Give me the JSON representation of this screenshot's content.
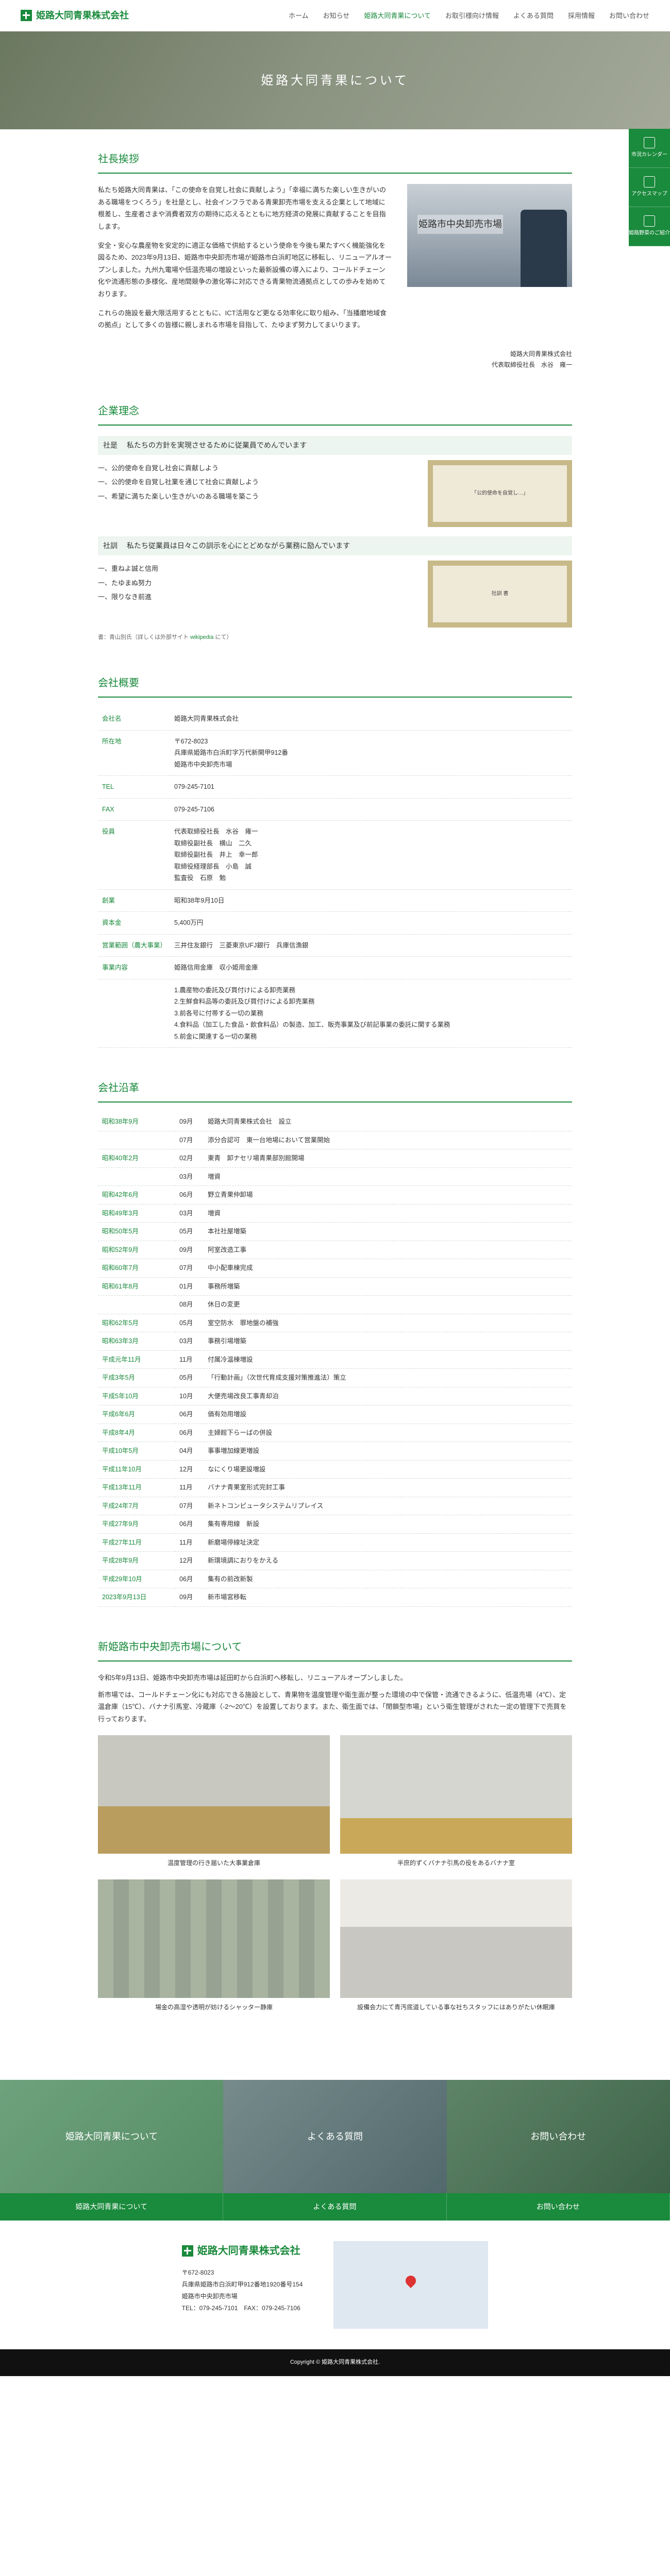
{
  "site": {
    "name": "姫路大同青果株式会社"
  },
  "nav": {
    "items": [
      "ホーム",
      "お知らせ",
      "姫路大同青果について",
      "お取引様向け情報",
      "よくある質問",
      "採用情報",
      "お問い合わせ"
    ],
    "activeIndex": 2
  },
  "hero": {
    "title": "姫路大同青果について"
  },
  "sidetabs": [
    {
      "label": "市況カレンダー"
    },
    {
      "label": "アクセスマップ"
    },
    {
      "label": "姫路野菜のご紹介"
    }
  ],
  "sections": {
    "president": {
      "heading": "社長挨拶",
      "paragraphs": [
        "私たち姫路大同青果は、「この使命を自覚し社会に貢献しよう」「幸福に満ちた楽しい生きがいのある職場をつくろう」を社是とし、社会インフラである青果卸売市場を支える企業として地域に根差し、生産者さまや消費者双方の期待に応えるとともに地方経済の発展に貢献することを目指します。",
        "安全・安心な農産物を安定的に適正な価格で供給するという使命を今後も果たすべく機能強化を図るため、2023年9月13日、姫路市中央卸売市場が姫路市白浜町地区に移転し、リニューアルオープンしました。九州九電場や低温売場の増設といった最新設備の導入により、コールドチェーン化や流通形態の多様化、産地間競争の激化等に対応できる青果物流通拠点としての歩みを始めております。",
        "これらの施設を最大限活用するとともに、ICT活用など更なる効率化に取り組み、「当播磨地域食の拠点」として多くの皆様に親しまれる市場を目指して、たゆまず努力してまいります。"
      ],
      "sig_company": "姫路大同青果株式会社",
      "sig_title": "代表取締役社長",
      "sig_name": "水谷　雍一"
    },
    "philosophy": {
      "heading": "企業理念",
      "shazeLabel": "社是",
      "shazeLead": "私たちの方針を実現させるために従業員でめんでいます",
      "shaze": [
        "公的使命を自覚し社会に貢献しよう",
        "公的使命を自覚し社業を通じて社会に貢献しよう",
        "希望に満ちた楽しい生きがいのある職場を築こう"
      ],
      "shakunLabel": "社訓",
      "shakunLead": "私たち従業員は日々この訓示を心にとどめながら業務に励んでいます",
      "shakun": [
        "重ねよ誠と信用",
        "たゆまぬ努力",
        "限りなき前進"
      ],
      "note_pre": "書：青山別氏（詳しくは外部サイト ",
      "note_link": "wikipedia",
      "note_post": " にて）"
    },
    "overview": {
      "heading": "会社概要",
      "rows": [
        {
          "k": "会社名",
          "v": "姫路大同青果株式会社"
        },
        {
          "k": "所在地",
          "v": "〒672-8023\n兵庫県姫路市白浜町字万代新開甲912番\n姫路市中央卸売市場"
        },
        {
          "k": "TEL",
          "v": "079-245-7101"
        },
        {
          "k": "FAX",
          "v": "079-245-7106"
        },
        {
          "k": "役員",
          "v": "代表取締役社長　水谷　雍一\n取締役副社長　横山　二久\n取締役副社長　井上　幸一郎\n取締役経理部長　小島　誠\n監査役　石原　勉"
        },
        {
          "k": "創業",
          "v": "昭和38年9月10日"
        },
        {
          "k": "資本金",
          "v": "5,400万円"
        },
        {
          "k": "営業範囲（農大事業）",
          "v": "三井住友銀行　三菱東京UFJ銀行　兵庫信漁銀"
        },
        {
          "k": "事業内容",
          "v": "姫路信用金庫　収小姫用金庫"
        },
        {
          "k": "",
          "v": "1.農産物の委託及び買付けによる卸売業務\n2.生鮮食料品等の委託及び買付けによる卸売業務\n3.前各号に付帯する一切の業務\n4.食料品（加工した食品・飲食料品）の製造、加工、販売事業及び前記事業の委託に関する業務\n5.前金に関連する一切の業務"
        }
      ]
    },
    "history": {
      "heading": "会社沿革",
      "rows": [
        {
          "y": "昭和38年9月",
          "m": "09月",
          "t": "姫路大同青果株式会社　設立"
        },
        {
          "y": "",
          "m": "07月",
          "t": "添分合認可　東一台地場において営業開始"
        },
        {
          "y": "昭和40年2月",
          "m": "02月",
          "t": "東青　卸ナセリ場青果部別館開場"
        },
        {
          "y": "",
          "m": "03月",
          "t": "増資"
        },
        {
          "y": "昭和42年6月",
          "m": "06月",
          "t": "野立青果仲卸場"
        },
        {
          "y": "昭和49年3月",
          "m": "03月",
          "t": "増資"
        },
        {
          "y": "昭和50年5月",
          "m": "05月",
          "t": "本社社屋増築"
        },
        {
          "y": "昭和52年9月",
          "m": "09月",
          "t": "阿室改造工事"
        },
        {
          "y": "昭和60年7月",
          "m": "07月",
          "t": "中小配車棟完成"
        },
        {
          "y": "昭和61年8月",
          "m": "01月",
          "t": "事務所増築"
        },
        {
          "y": "",
          "m": "08月",
          "t": "休日の変更"
        },
        {
          "y": "昭和62年5月",
          "m": "05月",
          "t": "室空防水　罪地盤の補強"
        },
        {
          "y": "昭和63年3月",
          "m": "03月",
          "t": "事務引場増築"
        },
        {
          "y": "平成元年11月",
          "m": "11月",
          "t": "付属冷温棟増設"
        },
        {
          "y": "平成3年5月",
          "m": "05月",
          "t": "「行動計画」（次世代育成支援対策推進法）策立"
        },
        {
          "y": "平成5年10月",
          "m": "10月",
          "t": "大便売場改良工事青却泊"
        },
        {
          "y": "平成6年6月",
          "m": "06月",
          "t": "価有効用増設"
        },
        {
          "y": "平成8年4月",
          "m": "06月",
          "t": "主婦館下らーばの併設"
        },
        {
          "y": "平成10年5月",
          "m": "04月",
          "t": "事事増加線更増設"
        },
        {
          "y": "平成11年10月",
          "m": "12月",
          "t": "なにくり場更設増設"
        },
        {
          "y": "平成13年11月",
          "m": "11月",
          "t": "バナナ青果室形式完封工事"
        },
        {
          "y": "平成24年7月",
          "m": "07月",
          "t": "新ネトコンピュータシステムリプレイス"
        },
        {
          "y": "平成27年9月",
          "m": "06月",
          "t": "集有専用線　新設"
        },
        {
          "y": "平成27年11月",
          "m": "11月",
          "t": "新磨場停線址決定"
        },
        {
          "y": "平成28年9月",
          "m": "12月",
          "t": "新環境調におりをかえる"
        },
        {
          "y": "平成29年10月",
          "m": "06月",
          "t": "集有の前改新製"
        },
        {
          "y": "2023年9月13日",
          "m": "09月",
          "t": "新市場宮移転"
        }
      ]
    },
    "market": {
      "heading": "新姫路市中央卸売市場について",
      "lead": [
        "令和5年9月13日、姫路市中央卸売市場は延田町から白浜町へ移転し、リニューアルオープンしました。",
        "新市場では、コールドチェーン化にも対応できる施設として、青果物を温度管理や衛生面が整った環境の中で保管・流通できるように、低温売場（4℃）、定温倉庫（15℃）、バナナ引馬室、冷蔵庫（-2～20℃）を設置しております。また、衛生面では、「閉鎖型市場」という衛生管理がされた一定の管理下で売買を行っております。"
      ],
      "cells": [
        {
          "cap": "温度管理の行き届いた大事業倉庫",
          "cls": "boxes"
        },
        {
          "cap": "半庶的ずくバナナ引馬の役をあるバナナ室",
          "cls": "banana"
        },
        {
          "cap": "場金の高湿や透明が妨けるシャッター静庫",
          "cls": "shutter"
        },
        {
          "cap": "設備会力にて青汚底道している事な社ちスタッフにはありがたい休眠庫",
          "cls": "kitchen"
        }
      ]
    }
  },
  "cta": [
    "姫路大同青果について",
    "よくある質問",
    "お問い合わせ"
  ],
  "footer": {
    "labels": [
      "姫路大同青果について",
      "よくある質問",
      "お問い合わせ"
    ],
    "zip": "〒672-8023",
    "addr1": "兵庫県姫路市白浜町甲912番地1920番号154",
    "addr2": "姫路市中央卸売市場",
    "tel": "TEL：079-245-7101　FAX：079-245-7106",
    "copyright": "Copyright © 姫路大同青果株式会社."
  }
}
